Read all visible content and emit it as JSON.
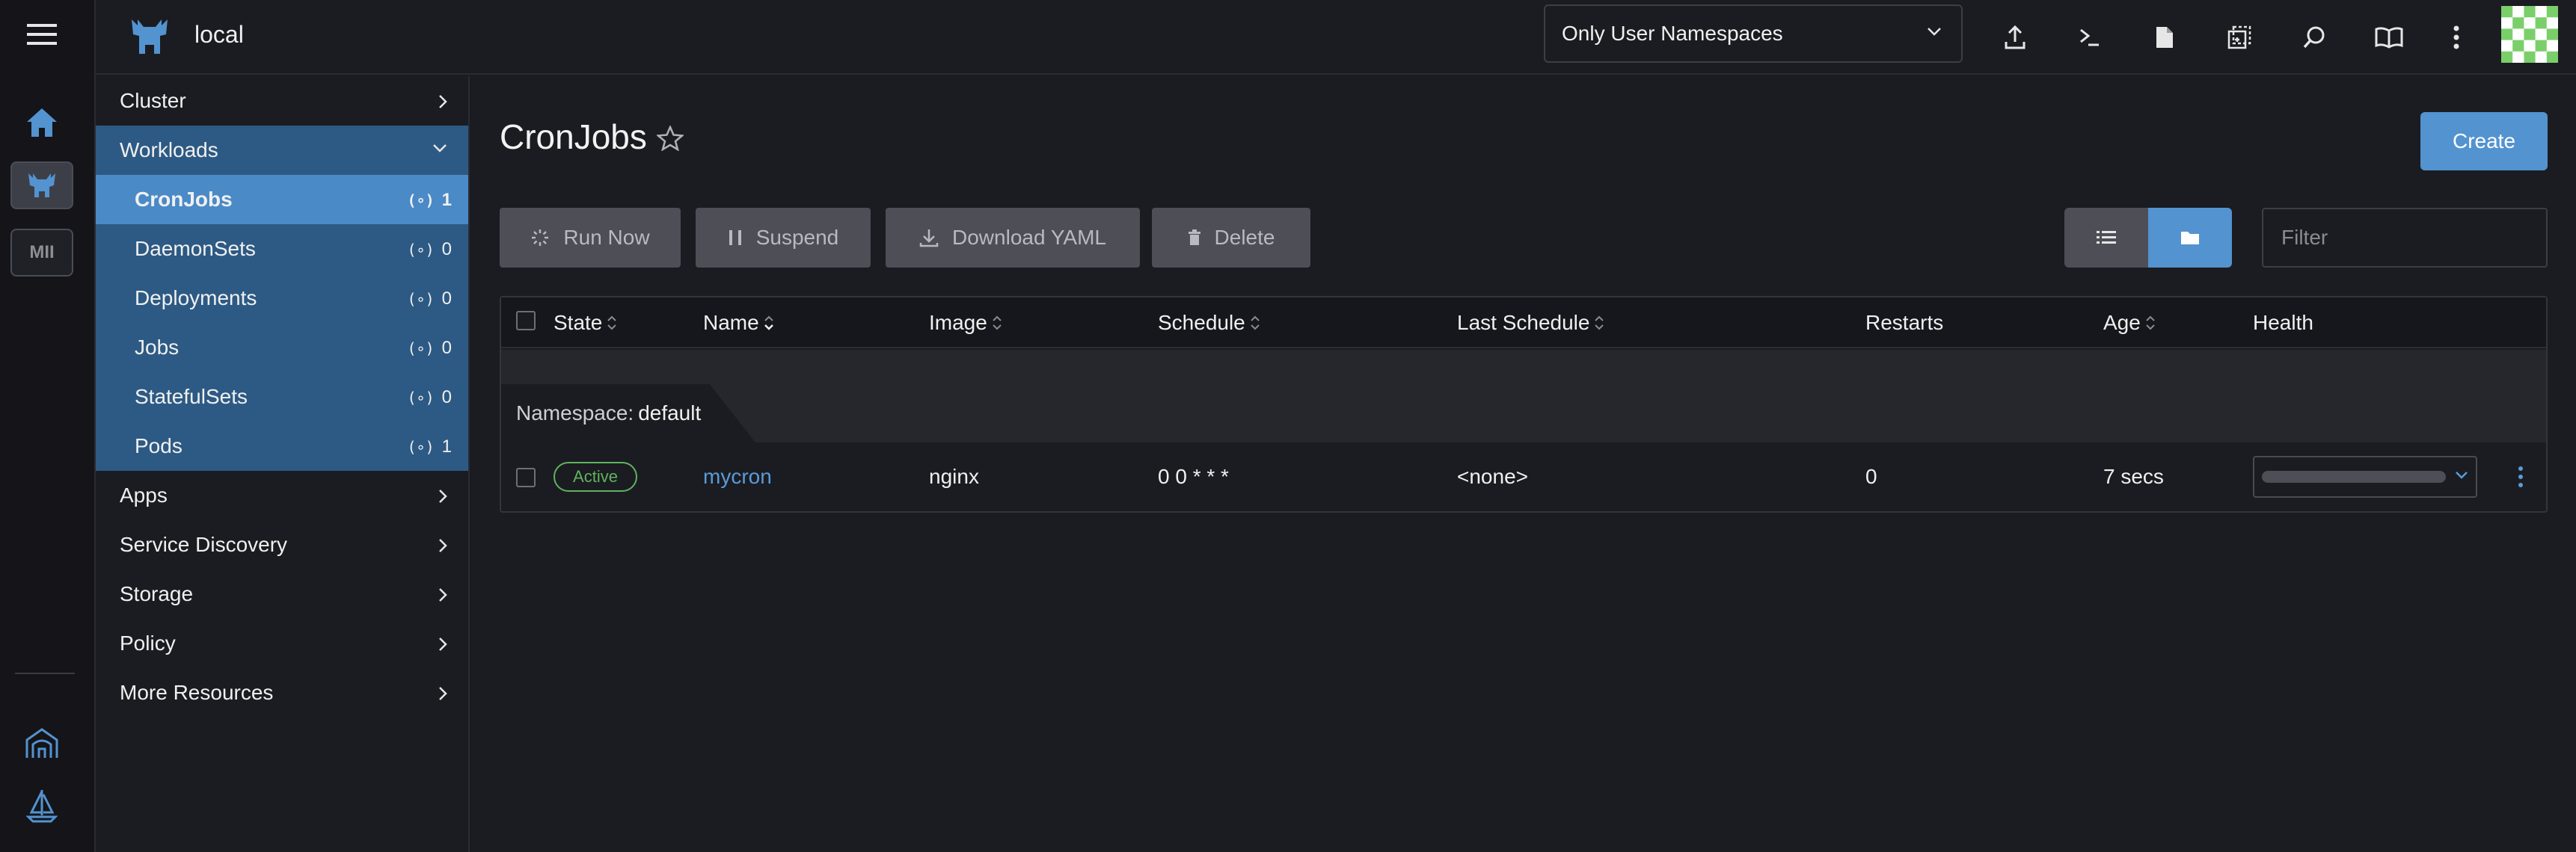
{
  "header": {
    "cluster_name": "local",
    "namespace_filter": "Only User Namespaces",
    "icons": [
      "upload-icon",
      "terminal-icon",
      "file-icon",
      "copy-file-icon",
      "search-icon",
      "book-icon",
      "kebab-menu-icon"
    ]
  },
  "rail": {
    "mii_label": "MII"
  },
  "sidebar": {
    "groups": [
      {
        "label": "Cluster"
      },
      {
        "label": "Workloads"
      },
      {
        "label": "Apps"
      },
      {
        "label": "Service Discovery"
      },
      {
        "label": "Storage"
      },
      {
        "label": "Policy"
      },
      {
        "label": "More Resources"
      }
    ],
    "workloads": [
      {
        "label": "CronJobs",
        "count": "1",
        "active": true
      },
      {
        "label": "DaemonSets",
        "count": "0"
      },
      {
        "label": "Deployments",
        "count": "0"
      },
      {
        "label": "Jobs",
        "count": "0"
      },
      {
        "label": "StatefulSets",
        "count": "0"
      },
      {
        "label": "Pods",
        "count": "1"
      }
    ],
    "count_icon": "(∘)"
  },
  "main": {
    "title": "CronJobs",
    "create_label": "Create",
    "actions": {
      "run_now": "Run Now",
      "suspend": "Suspend",
      "download_yaml": "Download YAML",
      "delete": "Delete"
    },
    "filter_placeholder": "Filter"
  },
  "table": {
    "columns": [
      "State",
      "Name",
      "Image",
      "Schedule",
      "Last Schedule",
      "Restarts",
      "Age",
      "Health"
    ],
    "group": {
      "prefix": "Namespace:",
      "name": "default"
    },
    "rows": [
      {
        "state": "Active",
        "name": "mycron",
        "image": "nginx",
        "schedule": "0 0 * * *",
        "last_schedule": "<none>",
        "restarts": "0",
        "age": "7 secs"
      }
    ]
  },
  "colors": {
    "accent": "#5393d0",
    "nav_open": "#2d5a84",
    "nav_active": "#4a8ac7",
    "active_badge": "#5fb35f",
    "link": "#5a9bd8"
  }
}
